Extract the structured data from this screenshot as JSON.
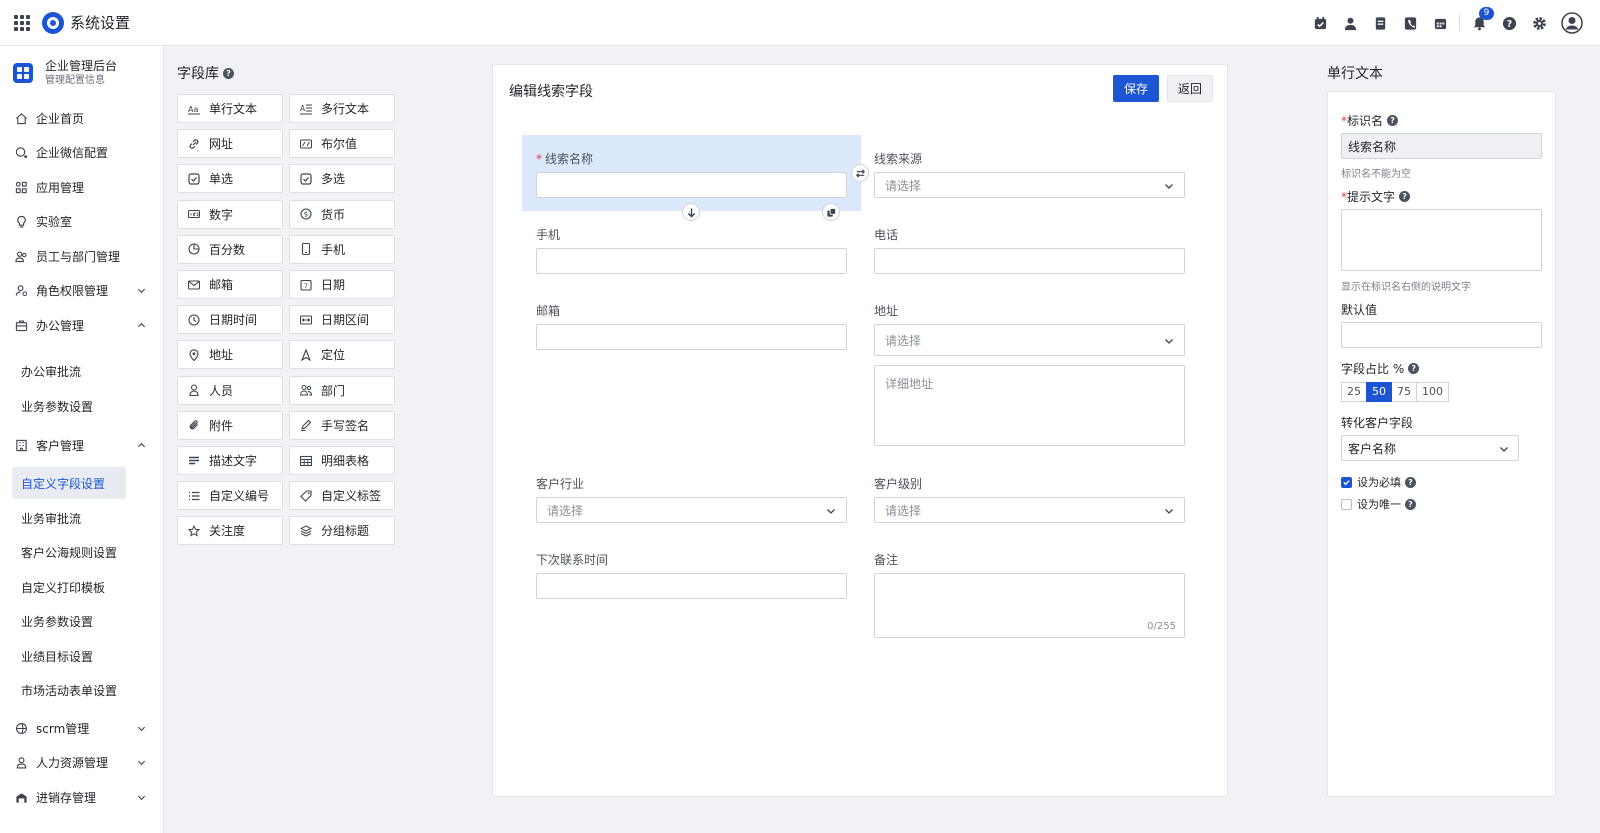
{
  "app": {
    "title": "系统设置"
  },
  "topbar": {
    "notification_count": "9",
    "icons": [
      "calendar-check-icon",
      "user-icon",
      "document-icon",
      "phone-icon",
      "calendar-icon",
      "bell-icon",
      "help-icon",
      "settings-icon",
      "avatar-icon"
    ]
  },
  "org": {
    "name": "企业管理后台",
    "subtitle": "管理配置信息"
  },
  "nav": {
    "home": "企业首页",
    "wecom": "企业微信配置",
    "apps": "应用管理",
    "lab": "实验室",
    "staff": "员工与部门管理",
    "roles": "角色权限管理",
    "office": "办公管理",
    "office_approval": "办公审批流",
    "office_params": "业务参数设置",
    "customer": "客户管理",
    "custom_fields": "自定义字段设置",
    "biz_approval": "业务审批流",
    "sea_rules": "客户公海规则设置",
    "print_tpl": "自定义打印模板",
    "biz_params": "业务参数设置",
    "targets": "业绩目标设置",
    "campaign_form": "市场活动表单设置",
    "scrm": "scrm管理",
    "hr": "人力资源管理",
    "inventory": "进销存管理"
  },
  "library": {
    "title": "字段库",
    "fields": [
      {
        "label": "单行文本",
        "icon": "text-aa-icon"
      },
      {
        "label": "多行文本",
        "icon": "multiline-text-icon"
      },
      {
        "label": "网址",
        "icon": "link-icon"
      },
      {
        "label": "布尔值",
        "icon": "boolean-icon"
      },
      {
        "label": "单选",
        "icon": "radio-box-icon"
      },
      {
        "label": "多选",
        "icon": "checkbox-icon"
      },
      {
        "label": "数字",
        "icon": "number-icon"
      },
      {
        "label": "货币",
        "icon": "currency-icon"
      },
      {
        "label": "百分数",
        "icon": "percent-pie-icon"
      },
      {
        "label": "手机",
        "icon": "mobile-icon"
      },
      {
        "label": "邮箱",
        "icon": "mail-icon"
      },
      {
        "label": "日期",
        "icon": "date-icon"
      },
      {
        "label": "日期时间",
        "icon": "clock-icon"
      },
      {
        "label": "日期区间",
        "icon": "date-range-icon"
      },
      {
        "label": "地址",
        "icon": "map-pin-icon"
      },
      {
        "label": "定位",
        "icon": "location-arrow-icon"
      },
      {
        "label": "人员",
        "icon": "person-icon"
      },
      {
        "label": "部门",
        "icon": "group-icon"
      },
      {
        "label": "附件",
        "icon": "paperclip-icon"
      },
      {
        "label": "手写签名",
        "icon": "pen-icon"
      },
      {
        "label": "描述文字",
        "icon": "description-icon"
      },
      {
        "label": "明细表格",
        "icon": "table-icon"
      },
      {
        "label": "自定义编号",
        "icon": "list-number-icon"
      },
      {
        "label": "自定义标签",
        "icon": "tag-icon"
      },
      {
        "label": "关注度",
        "icon": "star-icon"
      },
      {
        "label": "分组标题",
        "icon": "layers-icon"
      }
    ]
  },
  "editor": {
    "title": "编辑线索字段",
    "save_label": "保存",
    "back_label": "返回",
    "select_placeholder": "请选择",
    "fields": {
      "lead_name": "线索名称",
      "lead_source": "线索来源",
      "mobile": "手机",
      "phone": "电话",
      "email": "邮箱",
      "address": "地址",
      "address_detail_placeholder": "详细地址",
      "industry": "客户行业",
      "level": "客户级别",
      "next_contact": "下次联系时间",
      "remark": "备注",
      "remark_count": "0/255"
    }
  },
  "props": {
    "title": "单行文本",
    "id_label": "标识名",
    "id_value": "线索名称",
    "id_hint": "标识名不能为空",
    "prompt_label": "提示文字",
    "prompt_hint": "显示在标识名右侧的说明文字",
    "default_label": "默认值",
    "ratio_label": "字段占比 %",
    "ratio_options": [
      "25",
      "50",
      "75",
      "100"
    ],
    "ratio_selected": "50",
    "convert_label": "转化客户字段",
    "convert_value": "客户名称",
    "required_label": "设为必填",
    "required_checked": true,
    "unique_label": "设为唯一",
    "unique_checked": false
  }
}
